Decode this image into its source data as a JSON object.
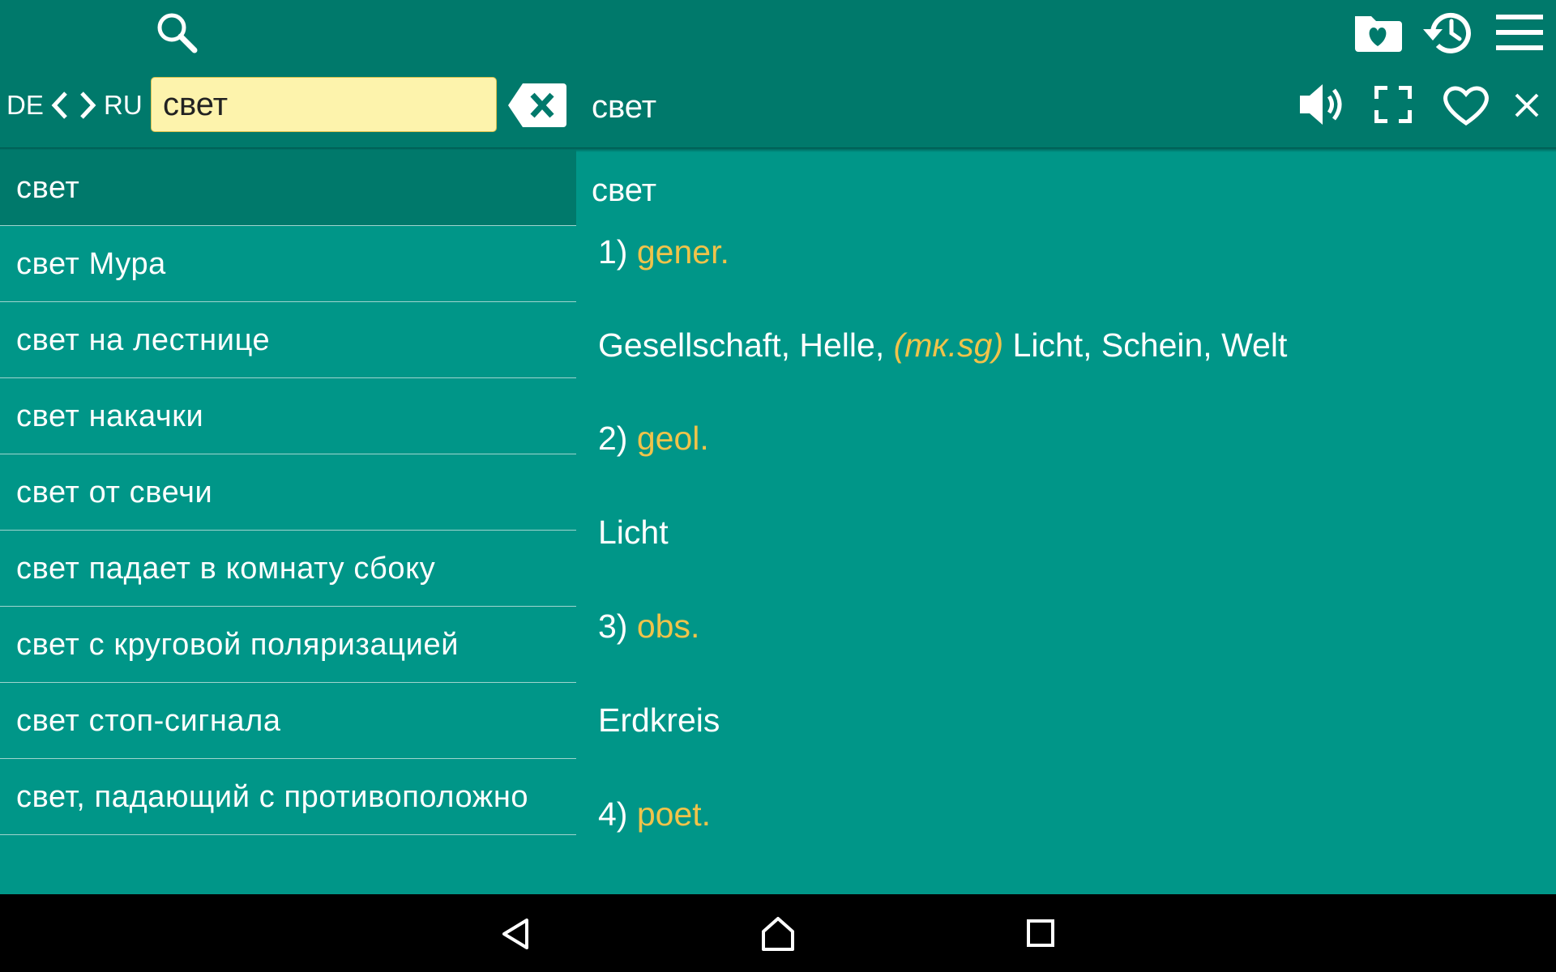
{
  "search": {
    "source_lang": "DE",
    "target_lang": "RU",
    "query": "свет"
  },
  "header": {
    "word": "свет"
  },
  "results": [
    {
      "text": "свет",
      "selected": true
    },
    {
      "text": "свет Мура"
    },
    {
      "text": "свет на лестнице"
    },
    {
      "text": "свет накачки"
    },
    {
      "text": "свет от свечи"
    },
    {
      "text": "свет падает в комнату сбоку"
    },
    {
      "text": "свет с круговой поляризацией"
    },
    {
      "text": "свет стоп-сигнала"
    },
    {
      "text": "свет, падающий с противоположно"
    }
  ],
  "detail": {
    "title": "свет",
    "senses": [
      {
        "number": "1)",
        "domain": "gener.",
        "translations_before": "Gesellschaft, Helle,",
        "note": "(тк.sg)",
        "translations_after": "Licht, Schein, Welt"
      },
      {
        "number": "2)",
        "domain": "geol.",
        "translations": "Licht"
      },
      {
        "number": "3)",
        "domain": "obs.",
        "translations": "Erdkreis"
      },
      {
        "number": "4)",
        "domain": "poet."
      }
    ]
  },
  "icons": {
    "search": "search-icon",
    "favorites_folder": "folder-heart-icon",
    "history": "history-icon",
    "menu": "hamburger-menu-icon",
    "swap_left": "chevron-left-icon",
    "swap_right": "chevron-right-icon",
    "clear": "backspace-icon",
    "speaker": "speaker-icon",
    "fullscreen": "fullscreen-icon",
    "favorite": "heart-icon",
    "close": "close-icon",
    "nav_back": "back-triangle-icon",
    "nav_home": "home-icon",
    "nav_recent": "recent-apps-icon"
  },
  "colors": {
    "primary": "#009688",
    "primary_dark": "#00796b",
    "accent": "#f0c34a",
    "search_bg": "#fdf3ac"
  }
}
